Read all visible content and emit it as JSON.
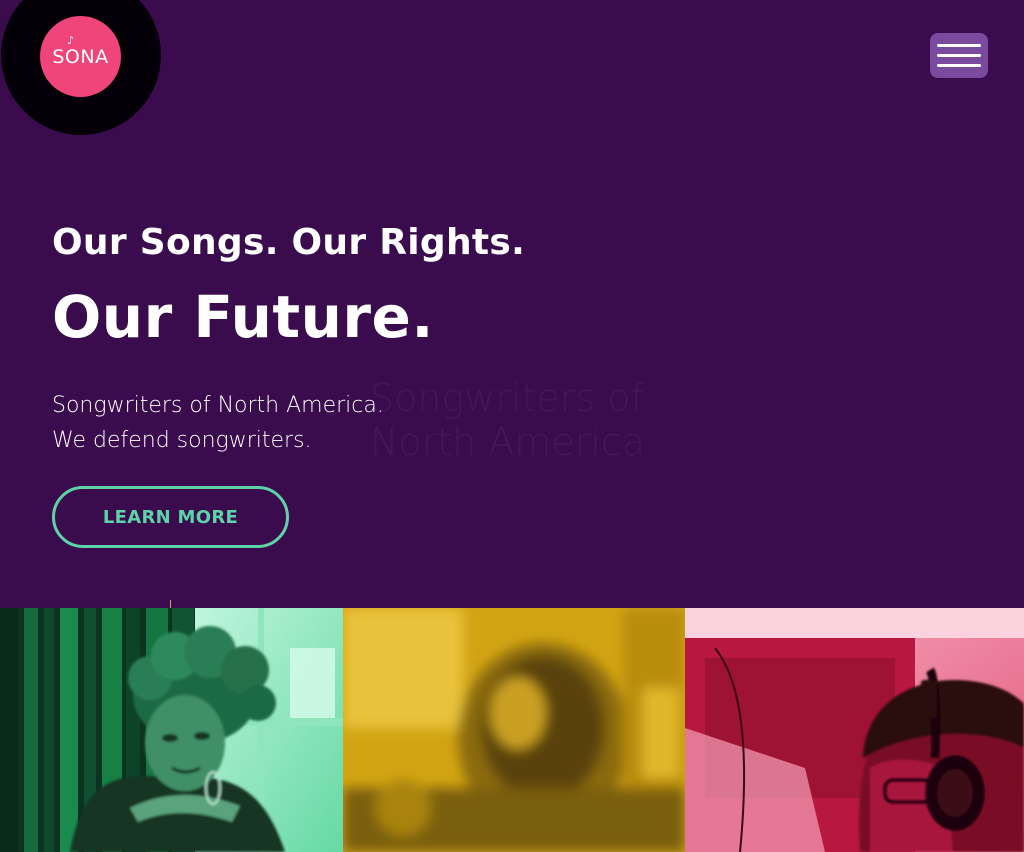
{
  "header": {
    "logo_text": "SONA",
    "logo_note": "♪",
    "menu_label": "menu"
  },
  "hero": {
    "tagline": "Our Songs. Our Rights.",
    "headline": "Our Future.",
    "sub_line1": "Songwriters of North America.",
    "sub_line2": "We defend songwriters.",
    "ghost_line1": "Songwriters of",
    "ghost_line2": "North America",
    "cta_label": "LEARN MORE"
  },
  "colors": {
    "background": "#3a0c4d",
    "accent_pink": "#f0457a",
    "accent_green": "#5fd3a8",
    "menu_bg": "#7a4a9e",
    "photo_green": "#0e3a22",
    "photo_yellow": "#d6a816",
    "photo_pink": "#c21c45"
  },
  "photos": [
    {
      "name": "woman-with-curly-hair",
      "tint": "green"
    },
    {
      "name": "blurred-studio-microphone",
      "tint": "yellow"
    },
    {
      "name": "man-with-headphones",
      "tint": "pink"
    }
  ]
}
